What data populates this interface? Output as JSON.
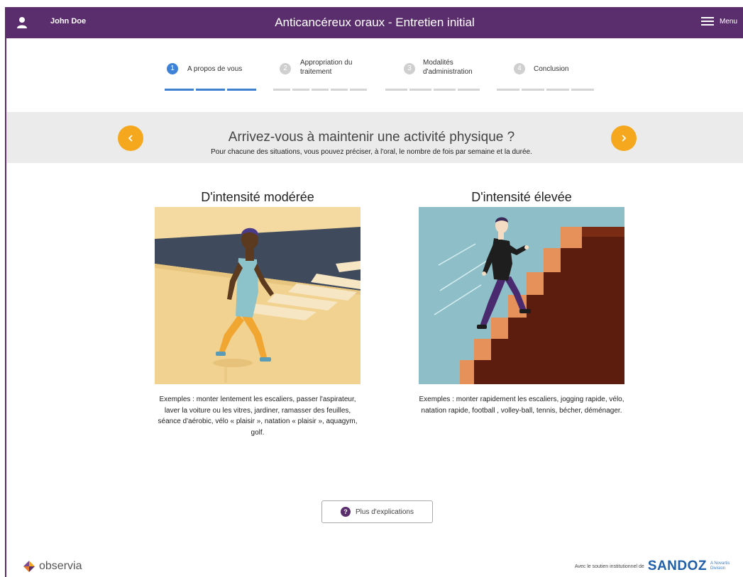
{
  "header": {
    "user_name": "John Doe",
    "title": "Anticancéreux oraux - Entretien initial",
    "menu_label": "Menu"
  },
  "stepper": {
    "steps": [
      {
        "number": "1",
        "label": "A propos de vous",
        "state": "active"
      },
      {
        "number": "2",
        "label": "Appropriation du traitement",
        "state": "inactive"
      },
      {
        "number": "3",
        "label": "Modalités d'administration",
        "state": "inactive"
      },
      {
        "number": "4",
        "label": "Conclusion",
        "state": "inactive"
      }
    ]
  },
  "question": {
    "title": "Arrivez-vous à maintenir une activité physique ?",
    "subtitle": "Pour chacune des situations, vous pouvez préciser, à l'oral, le nombre de fois par semaine et la durée."
  },
  "columns": {
    "moderate": {
      "title": "D'intensité modérée",
      "examples": "Exemples : monter lentement les escaliers, passer l'aspirateur, laver la voiture ou les vitres, jardiner, ramasser des feuilles, séance d'aérobic, vélo « plaisir », natation « plaisir », aquagym, golf."
    },
    "high": {
      "title": "D'intensité élevée",
      "examples": "Exemples : monter rapidement les escaliers, jogging rapide, vélo, natation rapide, football , volley-ball, tennis, bécher, déménager."
    }
  },
  "more_button": {
    "icon_text": "?",
    "label": "Plus d'explications"
  },
  "footer": {
    "logo_text": "observia",
    "sponsor_text": "Avec le soutien institutionnel de",
    "sponsor_brand": "SANDOZ",
    "sponsor_division": "A Novartis Division"
  },
  "colors": {
    "header_bg": "#5a2d6c",
    "accent_orange": "#f5a81e",
    "step_active": "#3d82d6",
    "band_bg": "#ebebeb"
  },
  "icons": {
    "user": "user-icon",
    "menu": "hamburger-menu-icon",
    "prev": "chevron-left-icon",
    "next": "chevron-right-icon",
    "help": "question-icon",
    "logo": "observia-logo-icon"
  }
}
